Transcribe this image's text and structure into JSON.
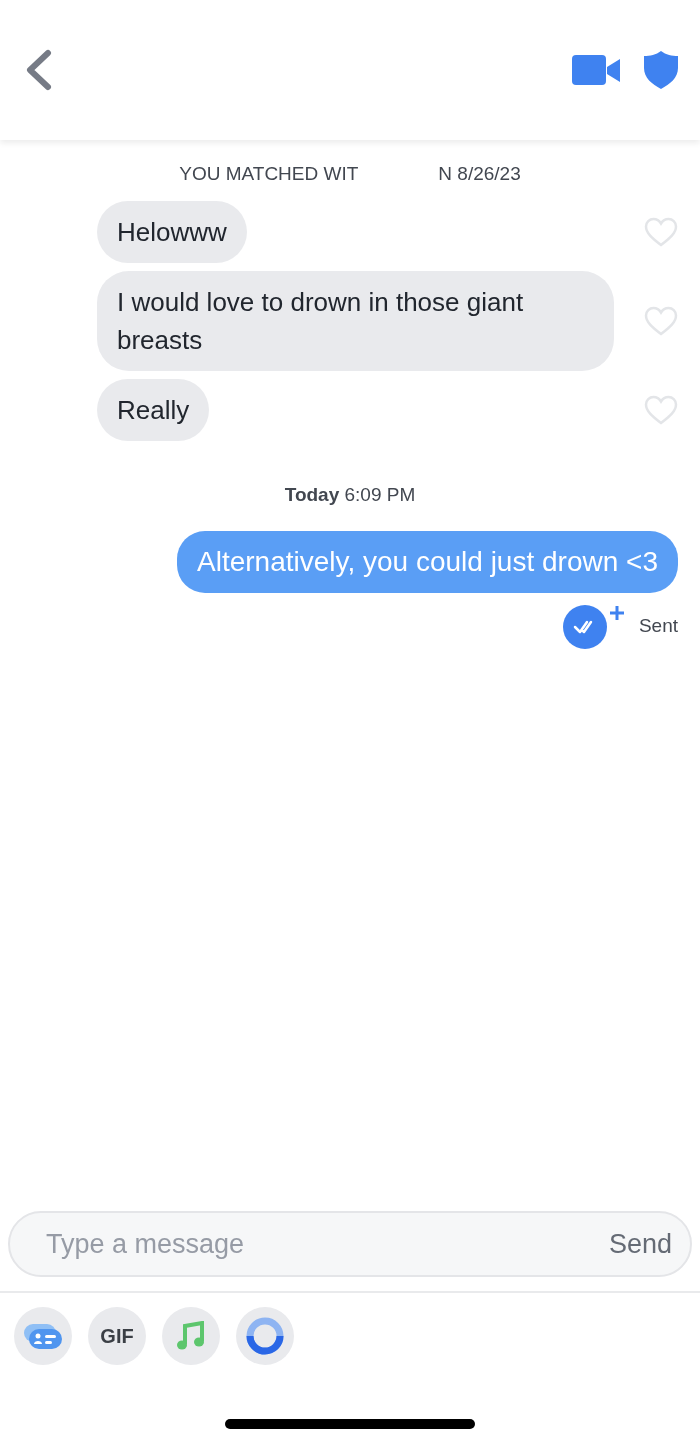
{
  "match_notice": [
    "YOU MATCHED WIT",
    "N 8/26/23"
  ],
  "messages": [
    {
      "kind": "received",
      "text": "Helowww",
      "liked": false
    },
    {
      "kind": "received",
      "text": "I would love to drown in those giant breasts",
      "liked": false
    },
    {
      "kind": "received",
      "text": "Really",
      "liked": false
    },
    {
      "kind": "timestamp",
      "day": "Today",
      "time": "6:09 PM"
    },
    {
      "kind": "sent",
      "text": "Alternatively, you could just drown <3"
    }
  ],
  "status": "Sent",
  "composer": {
    "placeholder": "Type a message",
    "send": "Send"
  },
  "toolbar": [
    {
      "kind": "card"
    },
    {
      "kind": "gif",
      "label": "GIF"
    },
    {
      "kind": "music"
    },
    {
      "kind": "ring"
    }
  ]
}
